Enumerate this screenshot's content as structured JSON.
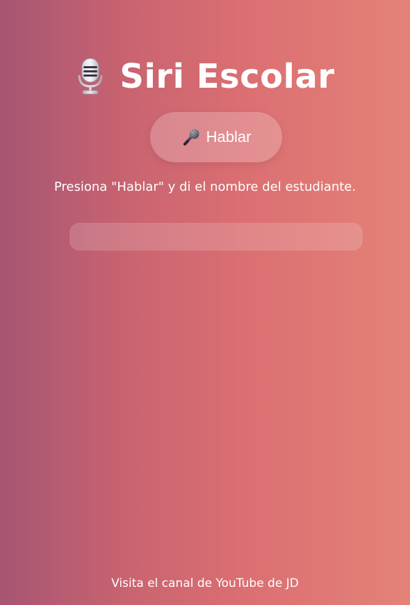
{
  "header": {
    "title": "Siri Escolar",
    "icon": "studio-microphone-icon"
  },
  "speak_button": {
    "label": "Hablar",
    "icon": "microphone-icon"
  },
  "instructions": "Presiona \"Hablar\" y di el nombre del estudiante.",
  "result_field": {
    "value": ""
  },
  "footer": {
    "link_label": "Visita el canal de YouTube de JD"
  },
  "colors": {
    "gradient_start": "#a65573",
    "gradient_end": "#e48278",
    "text": "#ffffff"
  }
}
